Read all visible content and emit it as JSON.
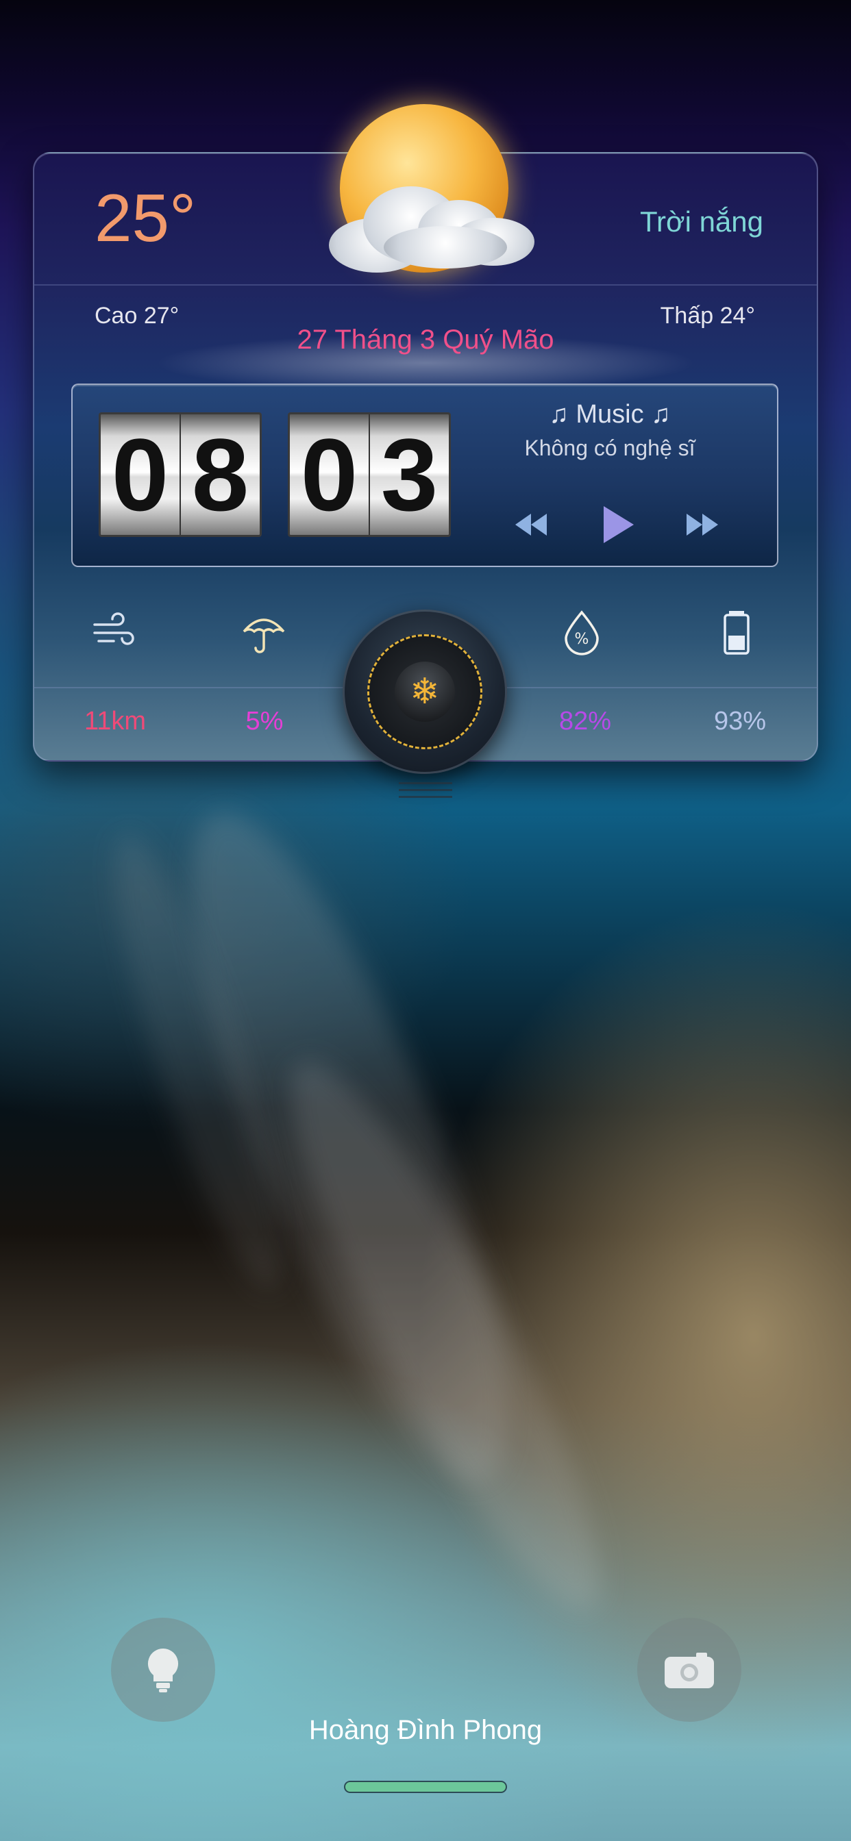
{
  "weather": {
    "temperature": "25°",
    "condition": "Trời nắng",
    "high": "Cao 27°",
    "low": "Thấp 24°",
    "lunar_date": "27 Tháng 3 Quý Mão",
    "icon": "sun-cloud-icon"
  },
  "clock": {
    "hour_digits": [
      "0",
      "8"
    ],
    "minute_digits": [
      "0",
      "3"
    ]
  },
  "music": {
    "title": "♫ Music ♫",
    "artist": "Không có nghệ sĩ",
    "controls": [
      "rewind-icon",
      "play-icon",
      "fast-forward-icon"
    ]
  },
  "stats": {
    "wind": {
      "icon": "wind-icon",
      "value": "11km",
      "color": "#f04a78"
    },
    "rain": {
      "icon": "umbrella-icon",
      "value": "5%",
      "color": "#e63fd6"
    },
    "humidity": {
      "icon": "humidity-drop-icon",
      "value": "82%",
      "color": "#b74ae8"
    },
    "battery": {
      "icon": "battery-icon",
      "value": "93%",
      "color": "#b7c6ea"
    }
  },
  "knob": {
    "icon": "snowflake-icon",
    "accent": "#f5b638"
  },
  "lockscreen": {
    "owner_name": "Hoàng Đình Phong",
    "left_button_icon": "flashlight-icon",
    "right_button_icon": "camera-icon"
  }
}
